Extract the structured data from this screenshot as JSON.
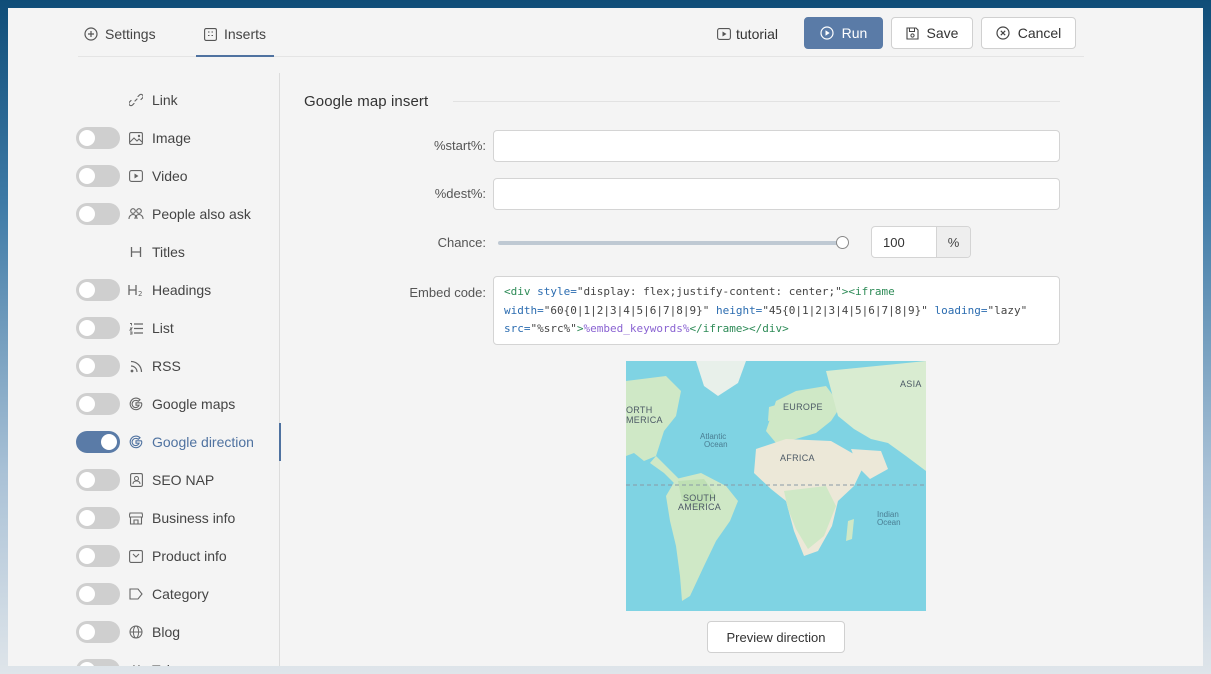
{
  "tabs": [
    {
      "label": "Settings",
      "icon": "plus-circle-icon"
    },
    {
      "label": "Inserts",
      "icon": "grid-icon"
    }
  ],
  "header": {
    "tutorial_label": "tutorial",
    "run_label": "Run",
    "save_label": "Save",
    "cancel_label": "Cancel"
  },
  "sidebar": {
    "items": [
      {
        "label": "Link",
        "icon": "link-icon",
        "has_toggle": false,
        "on": false
      },
      {
        "label": "Image",
        "icon": "image-icon",
        "has_toggle": true,
        "on": false
      },
      {
        "label": "Video",
        "icon": "video-icon",
        "has_toggle": true,
        "on": false
      },
      {
        "label": "People also ask",
        "icon": "people-icon",
        "has_toggle": true,
        "on": false
      },
      {
        "label": "Titles",
        "icon": "heading-icon",
        "has_toggle": false,
        "on": false
      },
      {
        "label": "Headings",
        "icon": "h2-icon",
        "has_toggle": true,
        "on": false
      },
      {
        "label": "List",
        "icon": "list-icon",
        "has_toggle": true,
        "on": false
      },
      {
        "label": "RSS",
        "icon": "rss-icon",
        "has_toggle": true,
        "on": false
      },
      {
        "label": "Google maps",
        "icon": "google-icon",
        "has_toggle": true,
        "on": false
      },
      {
        "label": "Google direction",
        "icon": "google-icon",
        "has_toggle": true,
        "on": true
      },
      {
        "label": "SEO NAP",
        "icon": "contact-card-icon",
        "has_toggle": true,
        "on": false
      },
      {
        "label": "Business info",
        "icon": "store-icon",
        "has_toggle": true,
        "on": false
      },
      {
        "label": "Product info",
        "icon": "product-icon",
        "has_toggle": true,
        "on": false
      },
      {
        "label": "Category",
        "icon": "tag-icon",
        "has_toggle": true,
        "on": false
      },
      {
        "label": "Blog",
        "icon": "globe-icon",
        "has_toggle": true,
        "on": false
      },
      {
        "label": "Token",
        "icon": "hash-icon",
        "has_toggle": true,
        "on": false
      }
    ]
  },
  "main": {
    "section_title": "Google map insert",
    "fields": {
      "start_label": "%start%:",
      "start_value": "",
      "dest_label": "%dest%:",
      "dest_value": "",
      "chance_label": "Chance:",
      "chance_value": "100",
      "chance_unit": "%",
      "chance_level": 1.0,
      "embed_label": "Embed code:"
    },
    "embed_code": {
      "line1": {
        "open": "<div",
        "attr1": " style=",
        "val1": "\"display: flex;justify-content: center;\"",
        "close1": ">",
        "tag2": "<iframe"
      },
      "line2": {
        "attr1": "width=",
        "val1": "\"60{0|1|2|3|4|5|6|7|8|9}\"",
        "attr2": " height=",
        "val2": "\"45{0|1|2|3|4|5|6|7|8|9}\"",
        "attr3": " loading=",
        "val3": "\"lazy\""
      },
      "line3": {
        "attr1": "src=",
        "val1": "\"%src%\"",
        "close1": ">",
        "kw": "%embed_keywords%",
        "end": "</iframe></div>"
      }
    },
    "map": {
      "labels": {
        "asia": "ASIA",
        "north": "ORTH",
        "america": "MERICA",
        "europe": "EUROPE",
        "atlantic": "Atlantic",
        "ocean": "Ocean",
        "africa": "AFRICA",
        "south": "SOUTH",
        "s_america": "AMERICA",
        "indian": "Indian",
        "indian_ocean": "Ocean"
      },
      "colors": {
        "water": "#7fd3e3",
        "land": "#cfe8c6",
        "desert": "#ece8d8"
      }
    },
    "preview_label": "Preview direction"
  },
  "colors": {
    "accent": "#5a7ba7",
    "active_text": "#4f72a0"
  }
}
